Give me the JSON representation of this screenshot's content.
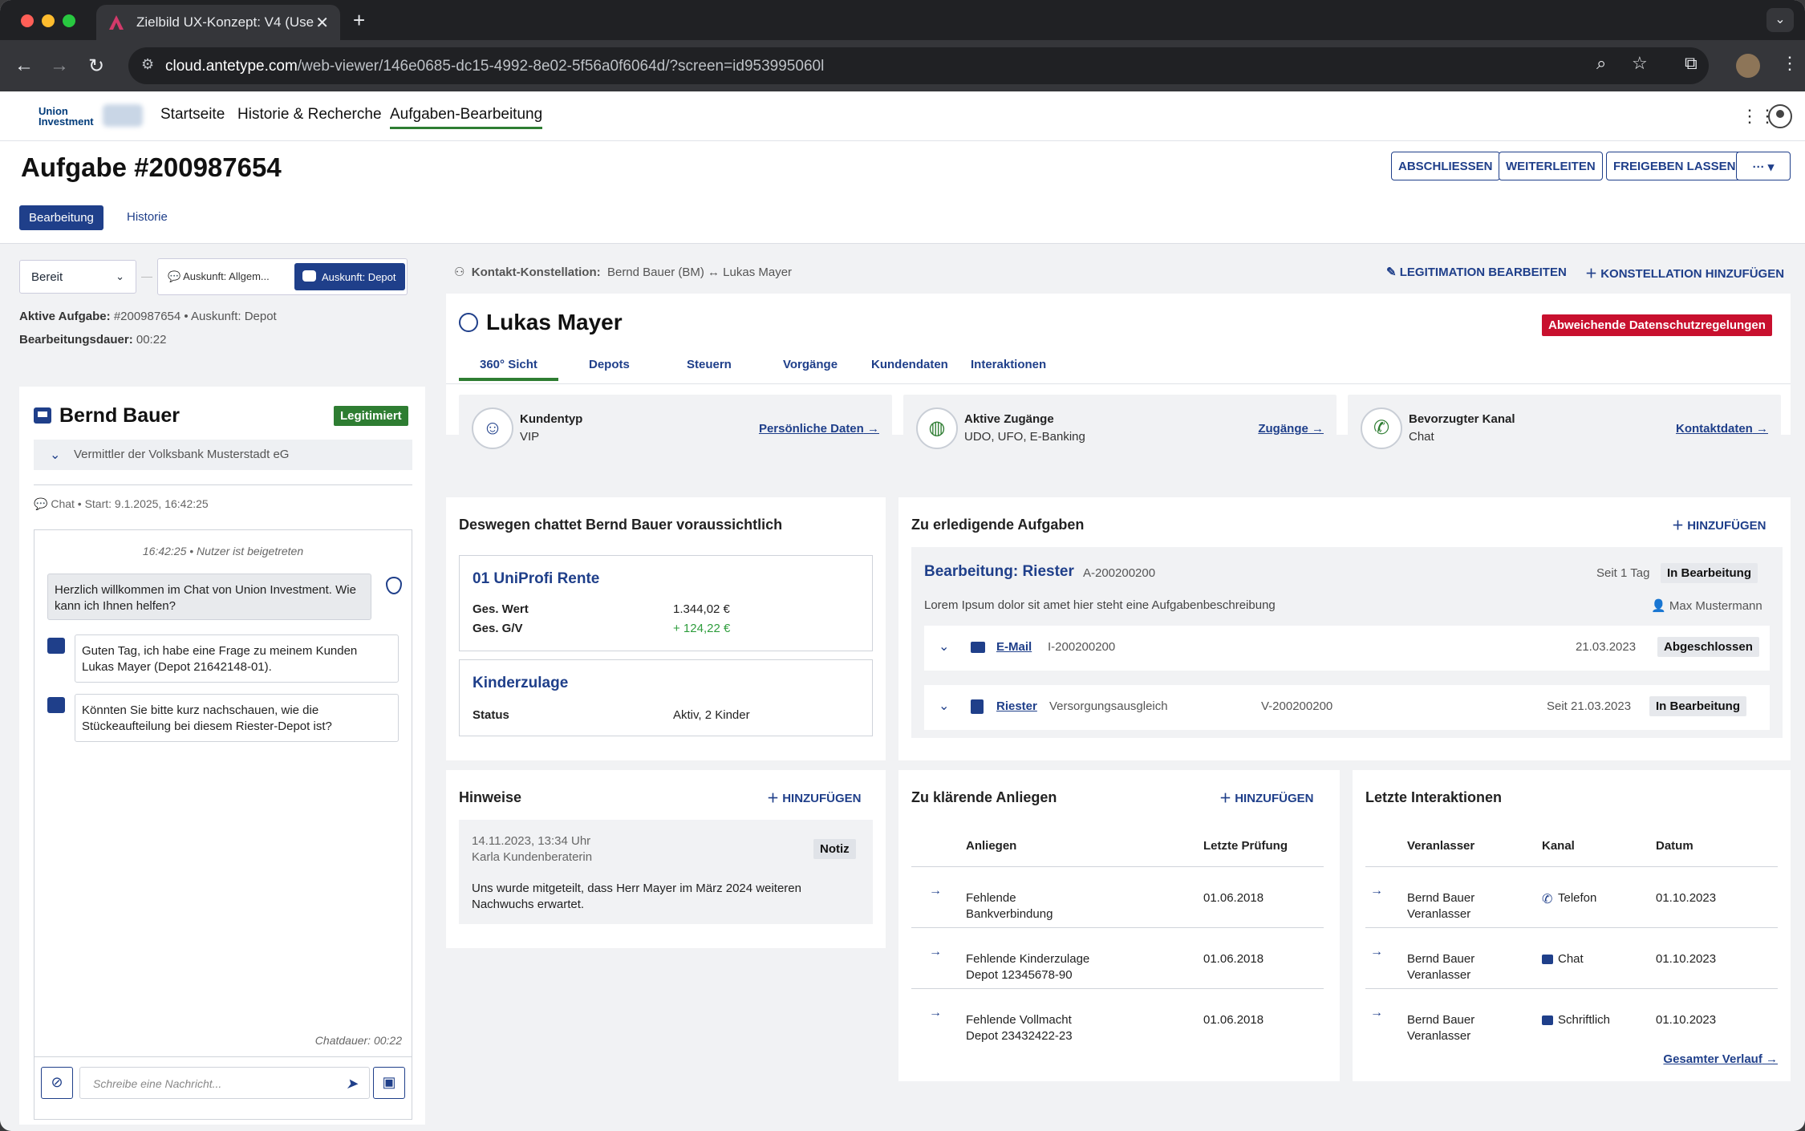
{
  "browser": {
    "tab_title": "Zielbild UX-Konzept: V4 (Use",
    "url_host": "cloud.antetype.com",
    "url_rest": "/web-viewer/146e0685-dc15-4992-8e02-5f56a0f6064d/?screen=id953995060l"
  },
  "app": {
    "logo_line1": "Union",
    "logo_line2": "Investment",
    "nav": [
      "Startseite",
      "Historie & Recherche",
      "Aufgaben-Bearbeitung"
    ]
  },
  "header": {
    "title": "Aufgabe #200987654",
    "actions": [
      "ABSCHLIESSEN",
      "WEITERLEITEN",
      "FREIGEBEN LASSEN",
      "···"
    ],
    "tabs": [
      "Bearbeitung",
      "Historie"
    ]
  },
  "left": {
    "status": "Bereit",
    "auskunft_1": "Auskunft: Allgem...",
    "auskunft_2": "Auskunft: Depot",
    "active_task_label": "Aktive Aufgabe:",
    "active_task_value": "#200987654 • Auskunft: Depot",
    "duration_label": "Bearbeitungsdauer:",
    "duration_value": "00:22",
    "contact_name": "Bernd Bauer",
    "legit_badge": "Legitimiert",
    "vermittler": "Vermittler der Volksbank Musterstadt eG",
    "chat_meta": "Chat • Start: 9.1.2025, 16:42:25",
    "chat_join": "16:42:25 • Nutzer ist beigetreten",
    "msg_bot": "Herzlich willkommen im Chat von Union Investment. Wie kann ich Ihnen helfen?",
    "msg_user1": "Guten Tag, ich habe eine Frage zu meinem Kunden Lukas Mayer (Depot 21642148-01).",
    "msg_user2": "Könnten Sie bitte kurz nachschauen, wie die Stückeaufteilung bei diesem Riester-Depot ist?",
    "chat_duration": "Chatdauer: 00:22",
    "input_placeholder": "Schreibe eine Nachricht..."
  },
  "main": {
    "konst_label": "Kontakt-Konstellation:",
    "konst_value": "Bernd Bauer (BM)  ↔  Lukas Mayer",
    "action_legit": "LEGITIMATION BEARBEITEN",
    "action_konst": "KONSTELLATION HINZUFÜGEN",
    "customer_name": "Lukas Mayer",
    "privacy_badge": "Abweichende Datenschutzregelungen",
    "tabs": [
      "360° Sicht",
      "Depots",
      "Steuern",
      "Vorgänge",
      "Kundendaten",
      "Interaktionen"
    ],
    "info_boxes": [
      {
        "title": "Kundentyp",
        "value": "VIP",
        "link": "Persönliche Daten",
        "icon": "vip-icon"
      },
      {
        "title": "Aktive Zugänge",
        "value": "UDO, UFO, E-Banking",
        "link": "Zugänge",
        "icon": "globe-icon"
      },
      {
        "title": "Bevorzugter Kanal",
        "value": "Chat",
        "link": "Kontaktdaten",
        "icon": "phone-icon"
      }
    ],
    "reason": {
      "title": "Deswegen chattet Bernd Bauer voraussichtlich",
      "product1": "01 UniProfi Rente",
      "p1_row1_label": "Ges. Wert",
      "p1_row1_value": "1.344,02 €",
      "p1_row2_label": "Ges. G/V",
      "p1_row2_value": "+ 124,22 €",
      "product2": "Kinderzulage",
      "p2_row1_label": "Status",
      "p2_row1_value": "Aktiv, 2 Kinder"
    },
    "tasks": {
      "title": "Zu erledigende Aufgaben",
      "add": "HINZUFÜGEN",
      "task_title": "Bearbeitung: Riester",
      "task_id": "A-200200200",
      "task_since": "Seit 1 Tag",
      "task_status": "In Bearbeitung",
      "task_desc": "Lorem Ipsum dolor sit amet hier steht eine Aufgabenbeschreibung",
      "task_user": "Max Mustermann",
      "sub1_link": "E-Mail",
      "sub1_id": "I-200200200",
      "sub1_date": "21.03.2023",
      "sub1_status": "Abgeschlossen",
      "sub2_link": "Riester",
      "sub2_type": "Versorgungsausgleich",
      "sub2_id": "V-200200200",
      "sub2_date": "Seit 21.03.2023",
      "sub2_status": "In Bearbeitung"
    },
    "hinweise": {
      "title": "Hinweise",
      "add": "HINZUFÜGEN",
      "date": "14.11.2023, 13:34 Uhr",
      "author": "Karla Kundenberaterin",
      "badge": "Notiz",
      "text": "Uns wurde mitgeteilt, dass Herr Mayer im März 2024 weiteren Nachwuchs erwartet."
    },
    "anliegen": {
      "title": "Zu klärende Anliegen",
      "add": "HINZUFÜGEN",
      "col1": "Anliegen",
      "col2": "Letzte Prüfung",
      "rows": [
        {
          "a": "Fehlende",
          "b": "Bankverbindung",
          "d": "01.06.2018"
        },
        {
          "a": "Fehlende Kinderzulage",
          "b": "Depot 12345678-90",
          "d": "01.06.2018"
        },
        {
          "a": "Fehlende Vollmacht",
          "b": "Depot 23432422-23",
          "d": "01.06.2018"
        }
      ]
    },
    "interaktionen": {
      "title": "Letzte Interaktionen",
      "col1": "Veranlasser",
      "col2": "Kanal",
      "col3": "Datum",
      "rows": [
        {
          "a": "Bernd Bauer",
          "b": "Veranlasser",
          "k": "Telefon",
          "d": "01.10.2023"
        },
        {
          "a": "Bernd Bauer",
          "b": "Veranlasser",
          "k": "Chat",
          "d": "01.10.2023"
        },
        {
          "a": "Bernd Bauer",
          "b": "Veranlasser",
          "k": "Schriftlich",
          "d": "01.10.2023"
        }
      ],
      "link": "Gesamter Verlauf"
    }
  }
}
